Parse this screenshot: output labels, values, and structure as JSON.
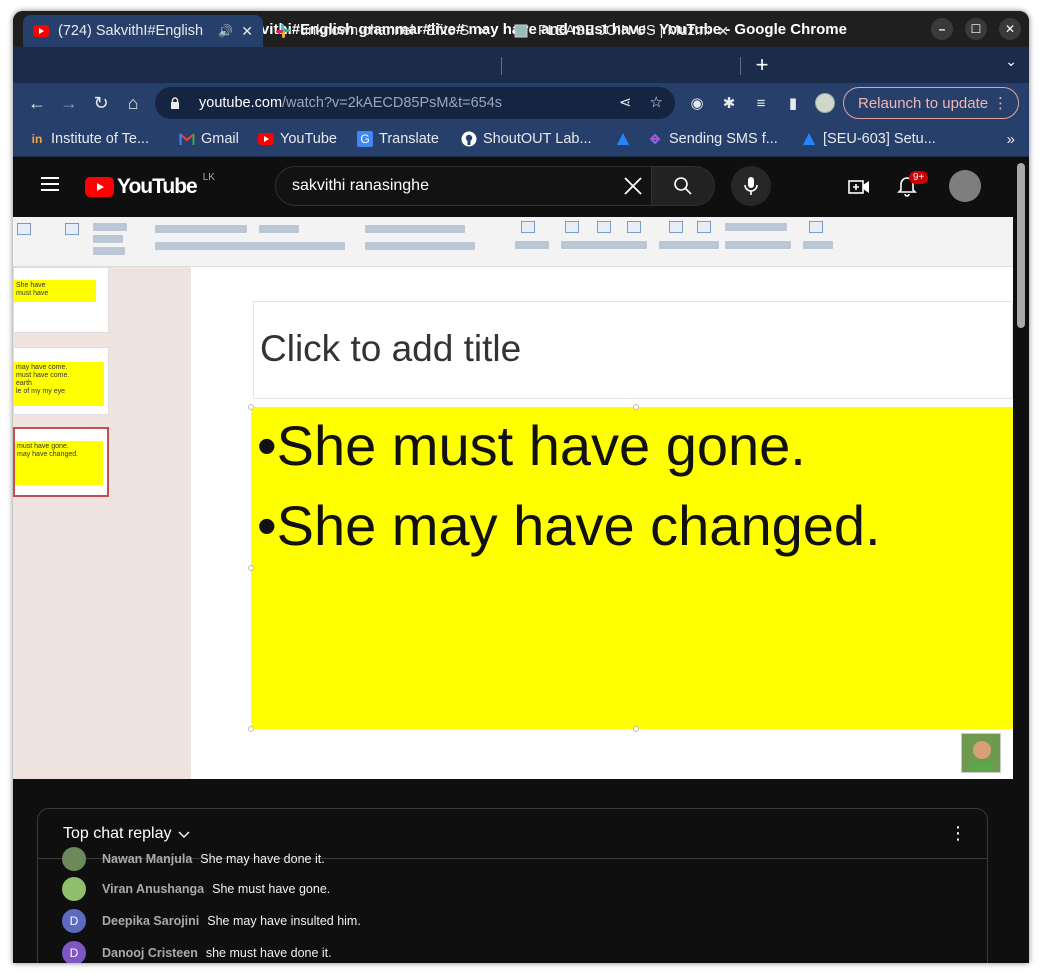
{
  "window": {
    "title": "(724) Sakvithi#English grammar#live# may have and must have - YouTube - Google Chrome"
  },
  "tabs": [
    {
      "title": "(724) SakvithI#English",
      "icon": "youtube-icon",
      "active": true
    },
    {
      "title": "unknown-channel - Efito S",
      "icon": "slack-icon",
      "active": false
    },
    {
      "title": "PLEASE JOIN US | Muzmar",
      "icon": "page-icon",
      "active": false
    }
  ],
  "toolbar": {
    "url_host": "youtube.com",
    "url_path": "/watch?v=2kAECD85PsM&t=654s",
    "relaunch_label": "Relaunch to update"
  },
  "bookmarks": [
    {
      "label": "Institute of Te...",
      "icon": "in-icon"
    },
    {
      "label": "Gmail",
      "icon": "gmail-icon"
    },
    {
      "label": "YouTube",
      "icon": "youtube-icon"
    },
    {
      "label": "Translate",
      "icon": "translate-icon"
    },
    {
      "label": "ShoutOUT Lab...",
      "icon": "github-icon"
    },
    {
      "label": "",
      "icon": "atlassian-icon"
    },
    {
      "label": "Sending SMS f...",
      "icon": "link-icon"
    },
    {
      "label": "[SEU-603] Setu...",
      "icon": "atlassian-icon"
    }
  ],
  "youtube": {
    "logo_text": "YouTube",
    "country": "LK",
    "search_value": "sakvithi ranasinghe",
    "notification_count": "9+"
  },
  "slide": {
    "title_placeholder": "Click to add title",
    "bullets": [
      "•She must have gone.",
      "•She may have changed."
    ],
    "thumbnails": [
      {
        "lines": [
          "She have",
          "must have"
        ]
      },
      {
        "lines": [
          "may have come.",
          "must have come.",
          "earth",
          "le of my my eye"
        ]
      },
      {
        "lines": [
          "must have gone.",
          "may have changed."
        ]
      }
    ]
  },
  "chat": {
    "header": "Top chat replay",
    "messages": [
      {
        "name": "Nawan Manjula",
        "text": "She may have done it.",
        "avatar_color": "#6a8a5a",
        "initial": ""
      },
      {
        "name": "Viran Anushanga",
        "text": "She must have gone.",
        "avatar_color": "#8fbf6a",
        "initial": ""
      },
      {
        "name": "Deepika Sarojini",
        "text": "She may have insulted him.",
        "avatar_color": "#5c6bc0",
        "initial": "D"
      },
      {
        "name": "Danooj Cristeen",
        "text": "she must have done it.",
        "avatar_color": "#7e57c2",
        "initial": "D"
      }
    ]
  },
  "colors": {
    "tabstrip": "#1b2b4a",
    "toolbar": "#273f6b",
    "yt_red": "#ff0000",
    "slide_highlight": "#ffff00"
  }
}
